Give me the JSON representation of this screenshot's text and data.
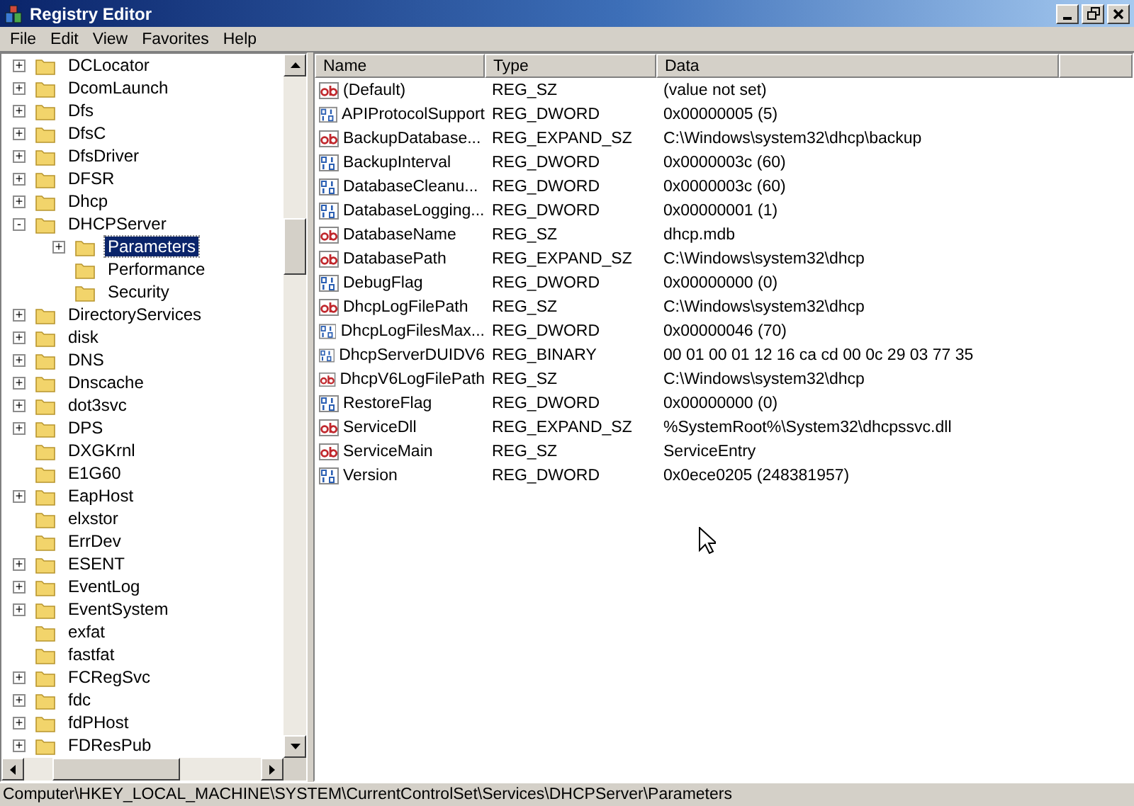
{
  "window": {
    "title": "Registry Editor"
  },
  "menu": [
    "File",
    "Edit",
    "View",
    "Favorites",
    "Help"
  ],
  "tree": {
    "items": [
      {
        "name": "DCLocator",
        "expander": "+",
        "selected": false
      },
      {
        "name": "DcomLaunch",
        "expander": "+",
        "selected": false
      },
      {
        "name": "Dfs",
        "expander": "+",
        "selected": false
      },
      {
        "name": "DfsC",
        "expander": "+",
        "selected": false
      },
      {
        "name": "DfsDriver",
        "expander": "+",
        "selected": false
      },
      {
        "name": "DFSR",
        "expander": "+",
        "selected": false
      },
      {
        "name": "Dhcp",
        "expander": "+",
        "selected": false
      },
      {
        "name": "DHCPServer",
        "expander": "-",
        "selected": false,
        "children": [
          {
            "name": "Parameters",
            "expander": "+",
            "selected": true
          },
          {
            "name": "Performance",
            "selected": false
          },
          {
            "name": "Security",
            "selected": false
          }
        ]
      },
      {
        "name": "DirectoryServices",
        "expander": "+",
        "selected": false
      },
      {
        "name": "disk",
        "expander": "+",
        "selected": false
      },
      {
        "name": "DNS",
        "expander": "+",
        "selected": false
      },
      {
        "name": "Dnscache",
        "expander": "+",
        "selected": false
      },
      {
        "name": "dot3svc",
        "expander": "+",
        "selected": false
      },
      {
        "name": "DPS",
        "expander": "+",
        "selected": false
      },
      {
        "name": "DXGKrnl",
        "selected": false
      },
      {
        "name": "E1G60",
        "selected": false
      },
      {
        "name": "EapHost",
        "expander": "+",
        "selected": false
      },
      {
        "name": "elxstor",
        "selected": false
      },
      {
        "name": "ErrDev",
        "selected": false
      },
      {
        "name": "ESENT",
        "expander": "+",
        "selected": false
      },
      {
        "name": "EventLog",
        "expander": "+",
        "selected": false
      },
      {
        "name": "EventSystem",
        "expander": "+",
        "selected": false
      },
      {
        "name": "exfat",
        "selected": false
      },
      {
        "name": "fastfat",
        "selected": false
      },
      {
        "name": "FCRegSvc",
        "expander": "+",
        "selected": false
      },
      {
        "name": "fdc",
        "expander": "+",
        "selected": false
      },
      {
        "name": "fdPHost",
        "expander": "+",
        "selected": false
      },
      {
        "name": "FDResPub",
        "expander": "+",
        "selected": false
      }
    ]
  },
  "table": {
    "columns": [
      "Name",
      "Type",
      "Data"
    ],
    "rows": [
      {
        "kind": "string",
        "name": "(Default)",
        "type": "REG_SZ",
        "data": "(value not set)"
      },
      {
        "kind": "binary",
        "name": "APIProtocolSupport",
        "type": "REG_DWORD",
        "data": "0x00000005 (5)"
      },
      {
        "kind": "string",
        "name": "BackupDatabase...",
        "type": "REG_EXPAND_SZ",
        "data": "C:\\Windows\\system32\\dhcp\\backup"
      },
      {
        "kind": "binary",
        "name": "BackupInterval",
        "type": "REG_DWORD",
        "data": "0x0000003c (60)"
      },
      {
        "kind": "binary",
        "name": "DatabaseCleanu...",
        "type": "REG_DWORD",
        "data": "0x0000003c (60)"
      },
      {
        "kind": "binary",
        "name": "DatabaseLogging...",
        "type": "REG_DWORD",
        "data": "0x00000001 (1)"
      },
      {
        "kind": "string",
        "name": "DatabaseName",
        "type": "REG_SZ",
        "data": "dhcp.mdb"
      },
      {
        "kind": "string",
        "name": "DatabasePath",
        "type": "REG_EXPAND_SZ",
        "data": "C:\\Windows\\system32\\dhcp"
      },
      {
        "kind": "binary",
        "name": "DebugFlag",
        "type": "REG_DWORD",
        "data": "0x00000000 (0)"
      },
      {
        "kind": "string",
        "name": "DhcpLogFilePath",
        "type": "REG_SZ",
        "data": "C:\\Windows\\system32\\dhcp"
      },
      {
        "kind": "binary",
        "name": "DhcpLogFilesMax...",
        "type": "REG_DWORD",
        "data": "0x00000046 (70)"
      },
      {
        "kind": "binary",
        "name": "DhcpServerDUIDV6",
        "type": "REG_BINARY",
        "data": "00 01 00 01 12 16 ca cd 00 0c 29 03 77 35"
      },
      {
        "kind": "string",
        "name": "DhcpV6LogFilePath",
        "type": "REG_SZ",
        "data": "C:\\Windows\\system32\\dhcp"
      },
      {
        "kind": "binary",
        "name": "RestoreFlag",
        "type": "REG_DWORD",
        "data": "0x00000000 (0)"
      },
      {
        "kind": "string",
        "name": "ServiceDll",
        "type": "REG_EXPAND_SZ",
        "data": "%SystemRoot%\\System32\\dhcpssvc.dll"
      },
      {
        "kind": "string",
        "name": "ServiceMain",
        "type": "REG_SZ",
        "data": "ServiceEntry"
      },
      {
        "kind": "binary",
        "name": "Version",
        "type": "REG_DWORD",
        "data": "0x0ece0205 (248381957)"
      }
    ]
  },
  "status_bar": "Computer\\HKEY_LOCAL_MACHINE\\SYSTEM\\CurrentControlSet\\Services\\DHCPServer\\Parameters"
}
